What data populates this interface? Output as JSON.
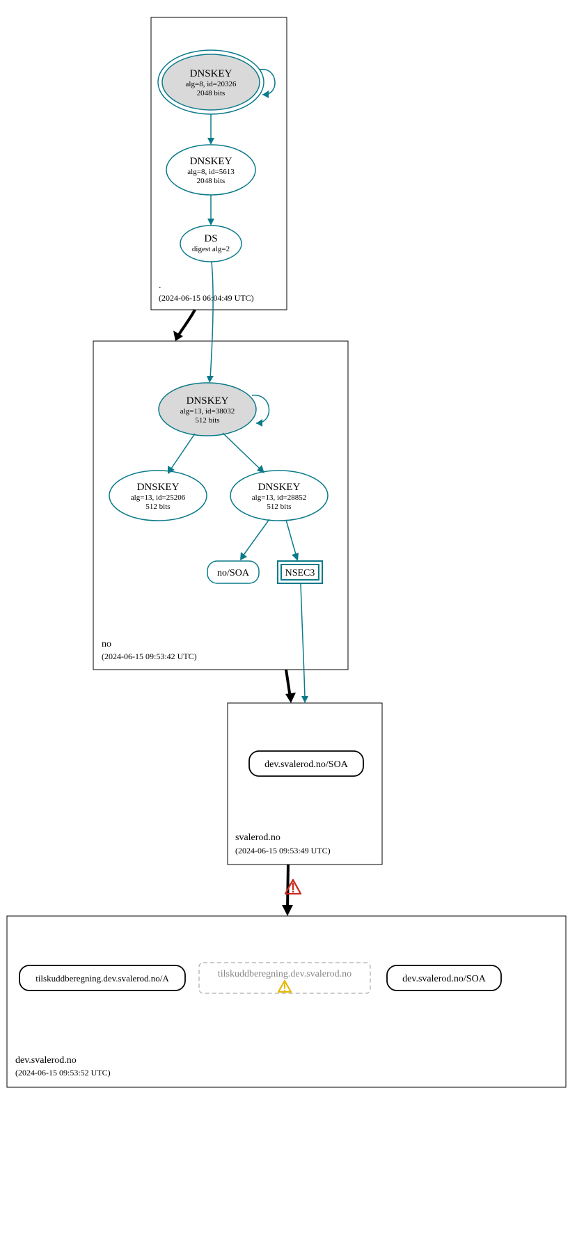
{
  "colors": {
    "teal": "#0a7a8a",
    "fillGrey": "#d9d9d9",
    "dashedGrey": "#bbbbbb",
    "warnRed": "#cc2a1e",
    "warnYellow": "#e6b800"
  },
  "zones": {
    "root": {
      "label": ".",
      "timestamp": "(2024-06-15 06:04:49 UTC)"
    },
    "no": {
      "label": "no",
      "timestamp": "(2024-06-15 09:53:42 UTC)"
    },
    "svalerod": {
      "label": "svalerod.no",
      "timestamp": "(2024-06-15 09:53:49 UTC)"
    },
    "dev": {
      "label": "dev.svalerod.no",
      "timestamp": "(2024-06-15 09:53:52 UTC)"
    }
  },
  "nodes": {
    "root_ksk": {
      "title": "DNSKEY",
      "line2": "alg=8, id=20326",
      "line3": "2048 bits"
    },
    "root_zsk": {
      "title": "DNSKEY",
      "line2": "alg=8, id=5613",
      "line3": "2048 bits"
    },
    "root_ds": {
      "title": "DS",
      "line2": "digest alg=2"
    },
    "no_ksk": {
      "title": "DNSKEY",
      "line2": "alg=13, id=38032",
      "line3": "512 bits"
    },
    "no_zsk1": {
      "title": "DNSKEY",
      "line2": "alg=13, id=25206",
      "line3": "512 bits"
    },
    "no_zsk2": {
      "title": "DNSKEY",
      "line2": "alg=13, id=28852",
      "line3": "512 bits"
    },
    "no_soa": {
      "label": "no/SOA"
    },
    "nsec3": {
      "label": "NSEC3"
    },
    "sval_soa": {
      "label": "dev.svalerod.no/SOA"
    },
    "dev_a": {
      "label": "tilskuddberegning.dev.svalerod.no/A"
    },
    "dev_gap": {
      "label": "tilskuddberegning.dev.svalerod.no"
    },
    "dev_soa": {
      "label": "dev.svalerod.no/SOA"
    }
  }
}
